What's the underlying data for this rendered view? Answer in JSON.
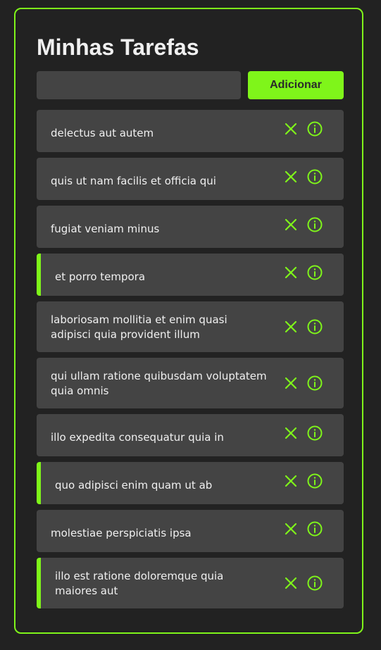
{
  "app": {
    "title": "Minhas Tarefas"
  },
  "form": {
    "input_value": "",
    "input_placeholder": "",
    "add_label": "Adicionar"
  },
  "icons": {
    "remove": "close-icon",
    "details": "info-icon"
  },
  "colors": {
    "accent": "#7ff51a",
    "background": "#222222",
    "card": "#444444",
    "text": "#f0f0f0"
  },
  "tasks": [
    {
      "title": "delectus aut autem",
      "completed": false
    },
    {
      "title": "quis ut nam facilis et officia qui",
      "completed": false
    },
    {
      "title": "fugiat veniam minus",
      "completed": false
    },
    {
      "title": "et porro tempora",
      "completed": true
    },
    {
      "title": "laboriosam mollitia et enim quasi adipisci quia provident illum",
      "completed": false
    },
    {
      "title": "qui ullam ratione quibusdam voluptatem quia omnis",
      "completed": false
    },
    {
      "title": "illo expedita consequatur quia in",
      "completed": false
    },
    {
      "title": "quo adipisci enim quam ut ab",
      "completed": true
    },
    {
      "title": "molestiae perspiciatis ipsa",
      "completed": false
    },
    {
      "title": "illo est ratione doloremque quia maiores aut",
      "completed": true
    }
  ]
}
